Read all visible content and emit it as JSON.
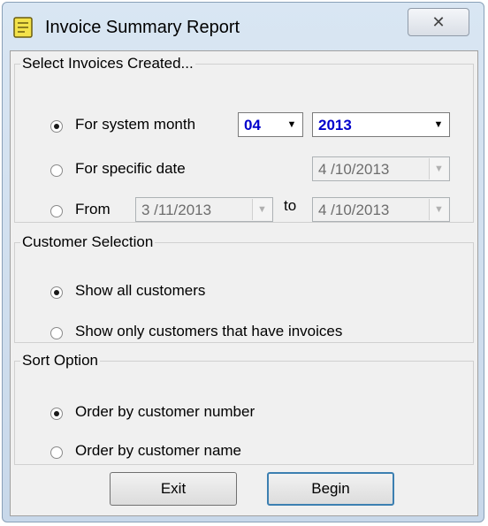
{
  "window": {
    "title": "Invoice Summary Report",
    "close_glyph": "✕"
  },
  "created": {
    "legend": "Select Invoices Created...",
    "system_month_label": "For system month",
    "month_value": "04",
    "year_value": "2013",
    "specific_date_label": "For specific date",
    "specific_date_value": "4 /10/2013",
    "from_label": "From",
    "from_value": "3 /11/2013",
    "to_label": "to",
    "to_value": "4 /10/2013",
    "selected": "system_month"
  },
  "customer": {
    "legend": "Customer Selection",
    "show_all_label": "Show all customers",
    "show_invoiced_label": "Show only customers that have invoices",
    "selected": "show_all"
  },
  "sort": {
    "legend": "Sort Option",
    "by_number_label": "Order by customer number",
    "by_name_label": "Order by customer name",
    "selected": "by_number"
  },
  "buttons": {
    "exit_label": "Exit",
    "begin_label": "Begin"
  },
  "icons": {
    "title": "report-icon",
    "dropdown": "chevron-down-icon"
  }
}
